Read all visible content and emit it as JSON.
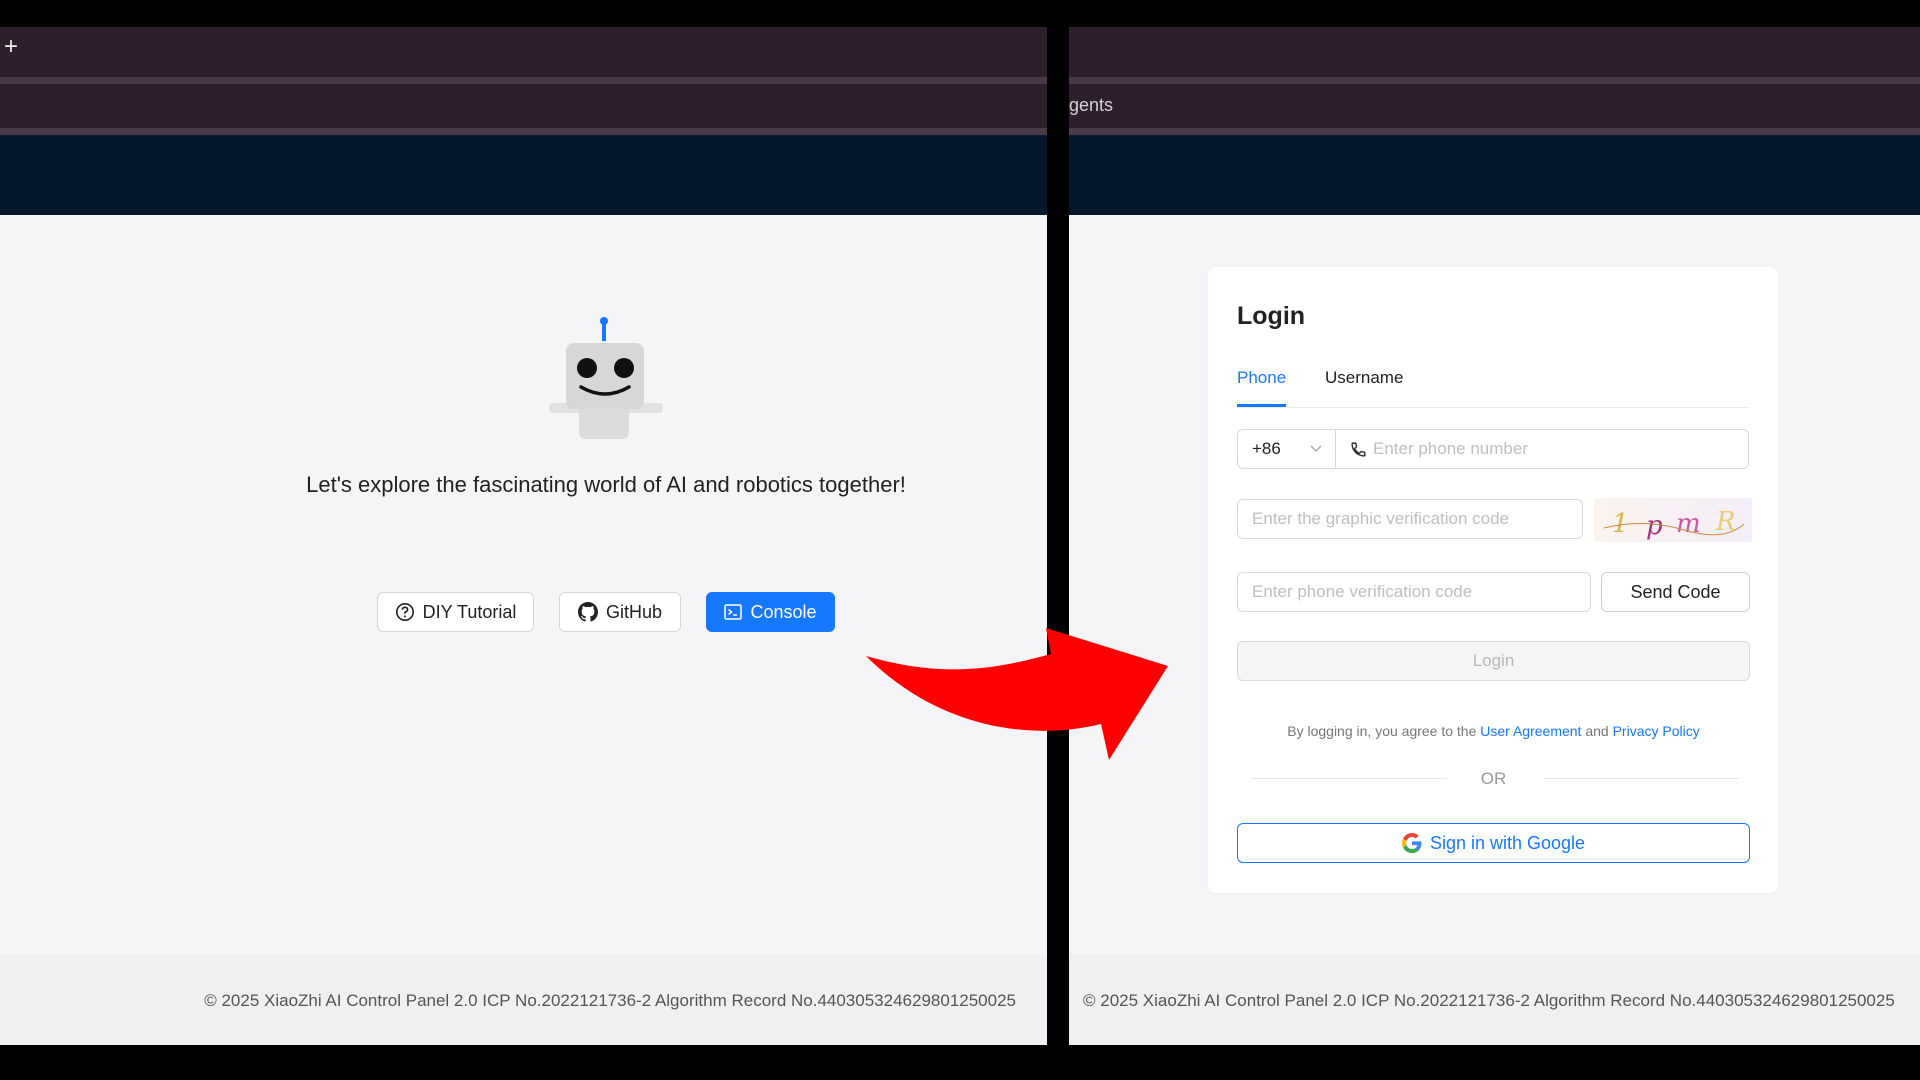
{
  "browser": {
    "new_tab_label": "+",
    "partial_tab_text": "gents"
  },
  "home": {
    "tagline": "Let's explore the fascinating world of AI and robotics together!",
    "buttons": {
      "diy": "DIY Tutorial",
      "github": "GitHub",
      "console": "Console"
    },
    "icons": [
      "question-circle-icon",
      "github-icon",
      "terminal-icon",
      "robot-logo"
    ]
  },
  "login": {
    "title": "Login",
    "tabs": [
      "Phone",
      "Username"
    ],
    "active_tab": "Phone",
    "country_code": "+86",
    "phone_placeholder": "Enter phone number",
    "captcha_placeholder": "Enter the graphic verification code",
    "captcha_text": "1pmR",
    "code_placeholder": "Enter phone verification code",
    "send_code": "Send Code",
    "login_button": "Login",
    "agree_prefix": "By logging in, you agree to the",
    "user_agreement": "User Agreement",
    "agree_and": "and",
    "privacy_policy": "Privacy Policy",
    "or": "OR",
    "google": "Sign in with Google"
  },
  "footer": {
    "copyright": "© 2025 XiaoZhi AI Control Panel 2.0 ICP No.2022121736-2 Algorithm Record No.440305324629801250025"
  },
  "colors": {
    "accent": "#1677ff",
    "arrow": "#ff0000",
    "browser_chrome": "#2e1f2c",
    "header_band": "#07182c"
  }
}
